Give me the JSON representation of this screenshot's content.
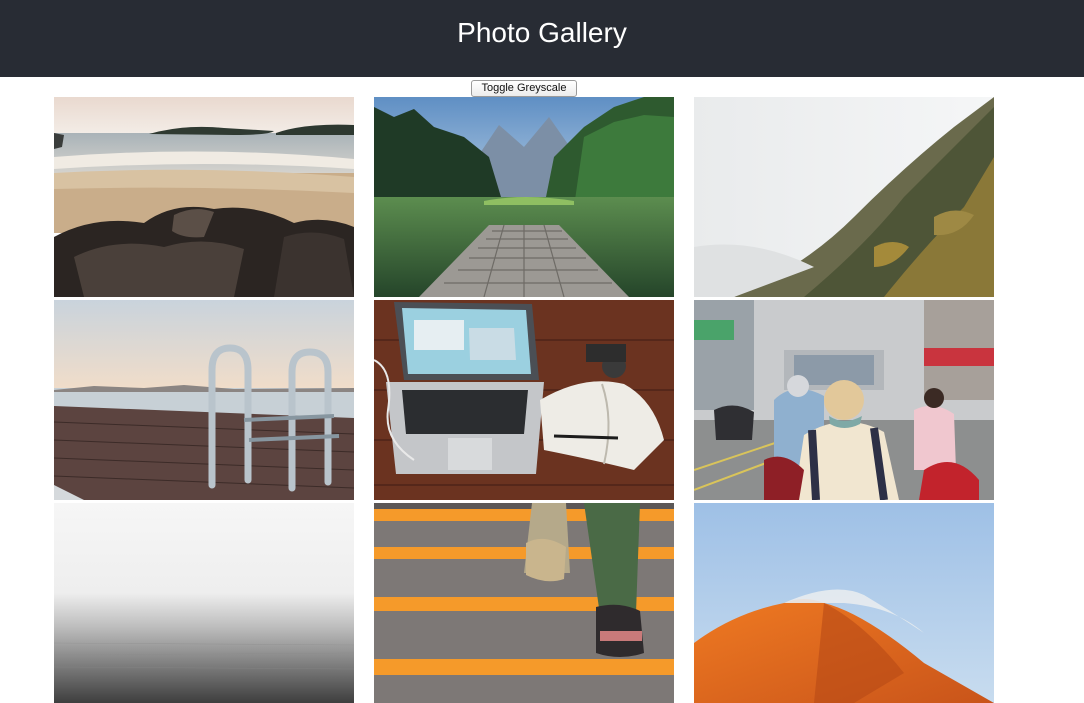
{
  "header": {
    "title": "Photo Gallery",
    "background_color": "#282c34",
    "title_color": "#ffffff"
  },
  "controls": {
    "toggle_label": "Toggle Greyscale"
  },
  "gallery": {
    "photos": [
      {
        "subject": "beach with rocks and islands"
      },
      {
        "subject": "wooden dock on a mountain lake"
      },
      {
        "subject": "foggy forested mountainside"
      },
      {
        "subject": "pool ladder on a wooden pier"
      },
      {
        "subject": "laptop and notebook on a wooden desk"
      },
      {
        "subject": "busy street with scooters"
      },
      {
        "subject": "misty grey sea"
      },
      {
        "subject": "feet climbing orange-striped stairs"
      },
      {
        "subject": "orange sand dune under blue sky"
      }
    ]
  }
}
